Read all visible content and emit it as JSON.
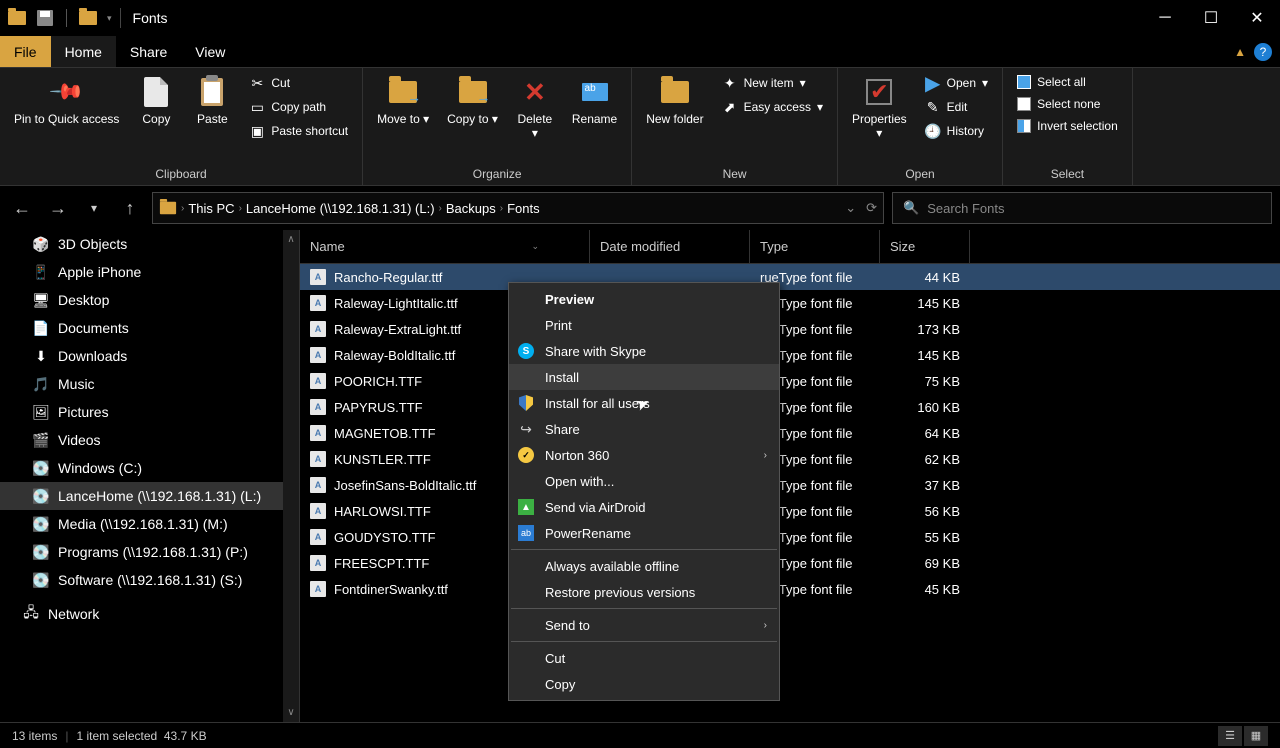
{
  "titlebar": {
    "title": "Fonts"
  },
  "tabs": {
    "file": "File",
    "home": "Home",
    "share": "Share",
    "view": "View"
  },
  "ribbon": {
    "clipboard": {
      "label": "Clipboard",
      "pin": "Pin to Quick access",
      "copy": "Copy",
      "paste": "Paste",
      "cut": "Cut",
      "copypath": "Copy path",
      "pasteshortcut": "Paste shortcut"
    },
    "organize": {
      "label": "Organize",
      "moveto": "Move to",
      "copyto": "Copy to",
      "delete": "Delete",
      "rename": "Rename"
    },
    "new": {
      "label": "New",
      "newfolder": "New folder",
      "newitem": "New item",
      "easyaccess": "Easy access"
    },
    "open": {
      "label": "Open",
      "properties": "Properties",
      "open": "Open",
      "edit": "Edit",
      "history": "History"
    },
    "select": {
      "label": "Select",
      "all": "Select all",
      "none": "Select none",
      "invert": "Invert selection"
    }
  },
  "breadcrumb": {
    "items": [
      "This PC",
      "LanceHome (\\\\192.168.1.31) (L:)",
      "Backups",
      "Fonts"
    ]
  },
  "search": {
    "placeholder": "Search Fonts"
  },
  "sidebar": {
    "items": [
      {
        "label": "3D Objects",
        "icon": "cube"
      },
      {
        "label": "Apple iPhone",
        "icon": "phone"
      },
      {
        "label": "Desktop",
        "icon": "desktop"
      },
      {
        "label": "Documents",
        "icon": "doc"
      },
      {
        "label": "Downloads",
        "icon": "download"
      },
      {
        "label": "Music",
        "icon": "music"
      },
      {
        "label": "Pictures",
        "icon": "picture"
      },
      {
        "label": "Videos",
        "icon": "video"
      },
      {
        "label": "Windows (C:)",
        "icon": "drive"
      },
      {
        "label": "LanceHome (\\\\192.168.1.31) (L:)",
        "icon": "netdrive",
        "selected": true
      },
      {
        "label": "Media (\\\\192.168.1.31) (M:)",
        "icon": "netdrive"
      },
      {
        "label": "Programs (\\\\192.168.1.31) (P:)",
        "icon": "netdrive"
      },
      {
        "label": "Software (\\\\192.168.1.31) (S:)",
        "icon": "netdrive"
      }
    ],
    "network": "Network"
  },
  "columns": {
    "name": "Name",
    "date": "Date modified",
    "type": "Type",
    "size": "Size"
  },
  "files": [
    {
      "name": "Rancho-Regular.ttf",
      "type": "rueType font file",
      "size": "44 KB",
      "selected": true
    },
    {
      "name": "Raleway-LightItalic.ttf",
      "type": "rueType font file",
      "size": "145 KB"
    },
    {
      "name": "Raleway-ExtraLight.ttf",
      "type": "rueType font file",
      "size": "173 KB"
    },
    {
      "name": "Raleway-BoldItalic.ttf",
      "type": "rueType font file",
      "size": "145 KB"
    },
    {
      "name": "POORICH.TTF",
      "type": "rueType font file",
      "size": "75 KB"
    },
    {
      "name": "PAPYRUS.TTF",
      "type": "rueType font file",
      "size": "160 KB"
    },
    {
      "name": "MAGNETOB.TTF",
      "type": "rueType font file",
      "size": "64 KB"
    },
    {
      "name": "KUNSTLER.TTF",
      "type": "rueType font file",
      "size": "62 KB"
    },
    {
      "name": "JosefinSans-BoldItalic.ttf",
      "type": "rueType font file",
      "size": "37 KB"
    },
    {
      "name": "HARLOWSI.TTF",
      "type": "rueType font file",
      "size": "56 KB"
    },
    {
      "name": "GOUDYSTO.TTF",
      "type": "rueType font file",
      "size": "55 KB"
    },
    {
      "name": "FREESCPT.TTF",
      "type": "rueType font file",
      "size": "69 KB"
    },
    {
      "name": "FontdinerSwanky.ttf",
      "type": "rueType font file",
      "size": "45 KB"
    }
  ],
  "context_menu": {
    "preview": "Preview",
    "print": "Print",
    "skype": "Share with Skype",
    "install": "Install",
    "installall": "Install for all users",
    "share": "Share",
    "norton": "Norton 360",
    "openwith": "Open with...",
    "airdroid": "Send via AirDroid",
    "powerrename": "PowerRename",
    "offline": "Always available offline",
    "restore": "Restore previous versions",
    "sendto": "Send to",
    "cut": "Cut",
    "copy": "Copy"
  },
  "status": {
    "items": "13 items",
    "selected": "1 item selected",
    "size": "43.7 KB"
  }
}
